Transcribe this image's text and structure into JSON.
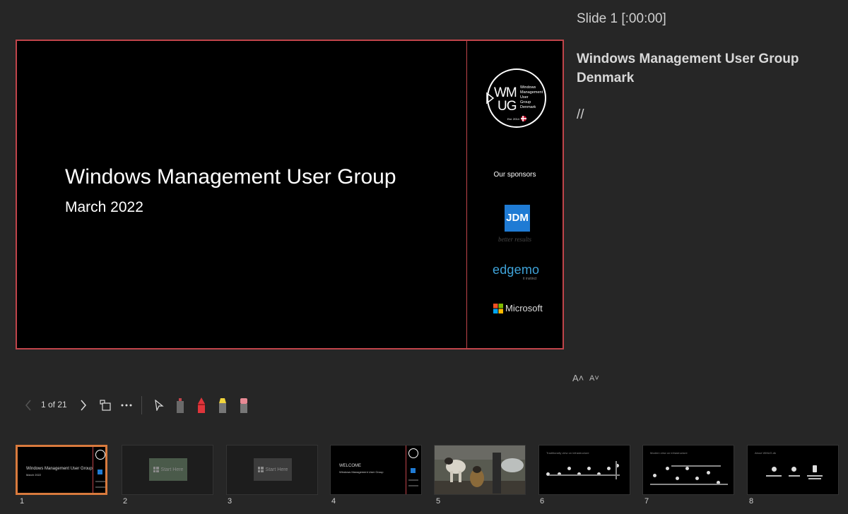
{
  "slide": {
    "title": "Windows Management User Group",
    "subtitle": "March 2022",
    "logo": {
      "line1": "WM",
      "line2": "UG",
      "caption_lines": [
        "Windows",
        "Management",
        "User",
        "Group",
        "Denmark"
      ],
      "est": "Est. 2014"
    },
    "sponsors_label": "Our sponsors",
    "sponsors": {
      "jdm": {
        "name": "JDM",
        "tagline": "better results"
      },
      "edgemo": {
        "name": "edgemo",
        "tagline": "it instinct"
      },
      "microsoft": {
        "name": "Microsoft"
      }
    },
    "colors": {
      "frame": "#c0444a",
      "jdm_blue": "#1f7bd4",
      "edgemo_blue": "#3fa3d9"
    }
  },
  "notes": {
    "slide_counter": "Slide 1 [:00:00]",
    "title": "Windows Management User Group Denmark",
    "body": "//",
    "font_increase": "A˄",
    "font_decrease": "A˅"
  },
  "toolbar": {
    "prev_icon": "chevron-left-icon",
    "page_indicator": "1 of 21",
    "next_icon": "chevron-right-icon",
    "view_all_icon": "slides-grid-icon",
    "more_icon": "ellipsis-icon",
    "pointer_icon": "pointer-icon",
    "pen_gray_icon": "laser-pen-icon",
    "pen_red_icon": "red-pen-icon",
    "highlighter_icon": "yellow-highlighter-icon",
    "eraser_icon": "eraser-icon"
  },
  "thumbnails": [
    {
      "number": "1",
      "active": true,
      "title": "Windows Management User Group",
      "subtitle": "March 2022"
    },
    {
      "number": "2",
      "active": false,
      "text": "Start Here"
    },
    {
      "number": "3",
      "active": false,
      "text": "Start Here"
    },
    {
      "number": "4",
      "active": false,
      "title": "WELCOME",
      "subtitle": "Windows Management User Group"
    },
    {
      "number": "5",
      "active": false
    },
    {
      "number": "6",
      "active": false,
      "title": "Traditionally view on infrastructure"
    },
    {
      "number": "7",
      "active": false,
      "title": "Modern view on infrastructure"
    },
    {
      "number": "8",
      "active": false,
      "title": "About WMUG.dk"
    }
  ],
  "accent_color": "#d97a3d"
}
